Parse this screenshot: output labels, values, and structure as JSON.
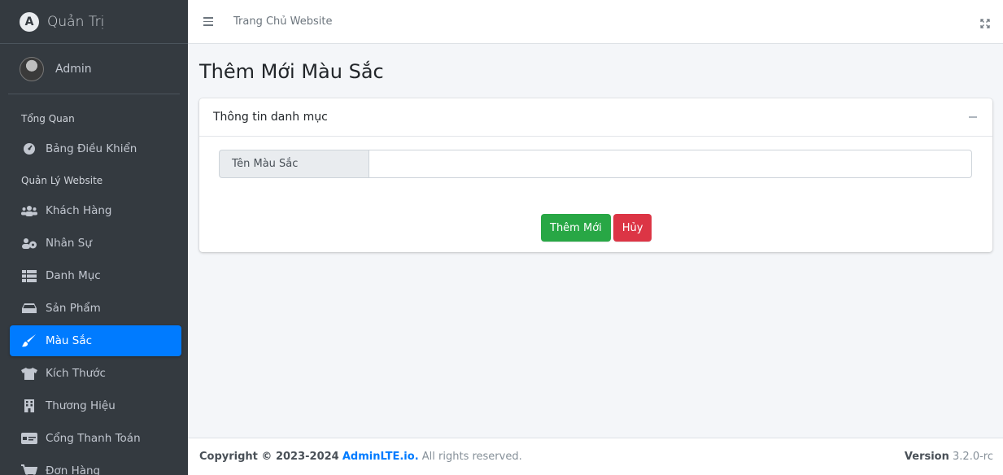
{
  "brand": {
    "title": "Quản Trị",
    "logo_letter": "A"
  },
  "user": {
    "name": "Admin"
  },
  "sidebar": {
    "headers": [
      "Tổng Quan",
      "Quản Lý Website"
    ],
    "items": [
      {
        "label": "Bảng Điều Khiển",
        "icon": "dashboard-icon"
      },
      {
        "label": "Khách Hàng",
        "icon": "users-icon"
      },
      {
        "label": "Nhân Sự",
        "icon": "staff-icon"
      },
      {
        "label": "Danh Mục",
        "icon": "list-icon"
      },
      {
        "label": "Sản Phẩm",
        "icon": "box-icon"
      },
      {
        "label": "Màu Sắc",
        "icon": "brush-icon",
        "active": true
      },
      {
        "label": "Kích Thước",
        "icon": "shirt-icon"
      },
      {
        "label": "Thương Hiệu",
        "icon": "building-icon"
      },
      {
        "label": "Cổng Thanh Toán",
        "icon": "payment-icon"
      },
      {
        "label": "Đơn Hàng",
        "icon": "cart-icon"
      }
    ]
  },
  "topbar": {
    "home_link": "Trang Chủ Website"
  },
  "page": {
    "title": "Thêm Mới Màu Sắc"
  },
  "card": {
    "title": "Thông tin danh mục",
    "field_label": "Tên Màu Sắc",
    "field_value": "",
    "submit_label": "Thêm Mới",
    "cancel_label": "Hủy"
  },
  "footer": {
    "copyright_prefix": "Copyright © 2023-2024",
    "copyright_link": "AdminLTE.io.",
    "copyright_suffix": "All rights reserved.",
    "version_label": "Version",
    "version_value": "3.2.0-rc"
  },
  "colors": {
    "sidebar_bg": "#343a40",
    "active": "#007bff",
    "success": "#28a745",
    "danger": "#dc3545"
  }
}
